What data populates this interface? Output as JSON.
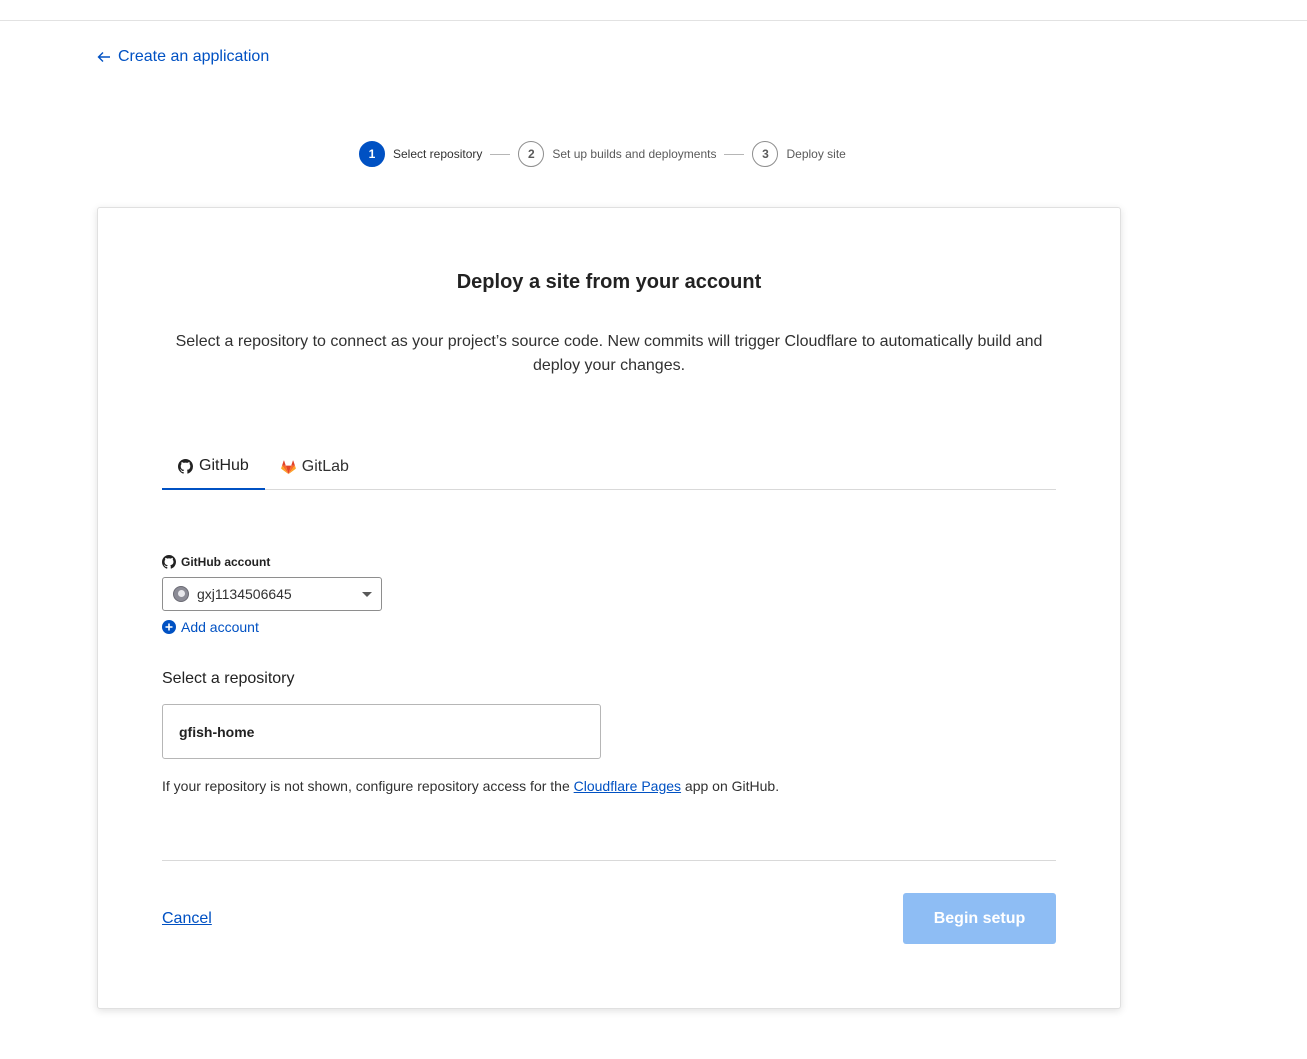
{
  "nav": {
    "back_label": "Create an application"
  },
  "stepper": {
    "steps": [
      {
        "number": "1",
        "label": "Select repository"
      },
      {
        "number": "2",
        "label": "Set up builds and deployments"
      },
      {
        "number": "3",
        "label": "Deploy site"
      }
    ]
  },
  "card": {
    "title": "Deploy a site from your account",
    "description": "Select a repository to connect as your project’s source code. New commits will trigger Cloudflare to automatically build and deploy your changes.",
    "tabs": [
      {
        "label": "GitHub",
        "icon": "github-icon"
      },
      {
        "label": "GitLab",
        "icon": "gitlab-icon"
      }
    ],
    "account_label": "GitHub account",
    "account_value": "gxj1134506645",
    "add_account_label": "Add account",
    "repo_label": "Select a repository",
    "repo_value": "gfish-home",
    "help_prefix": "If your repository is not shown, configure repository access for the ",
    "help_link": "Cloudflare Pages",
    "help_suffix": " app on GitHub.",
    "cancel_label": "Cancel",
    "begin_label": "Begin setup"
  },
  "colors": {
    "accent": "#0051c3",
    "button_disabled": "#8ebdf4",
    "gitlab_orange": "#e24329"
  }
}
